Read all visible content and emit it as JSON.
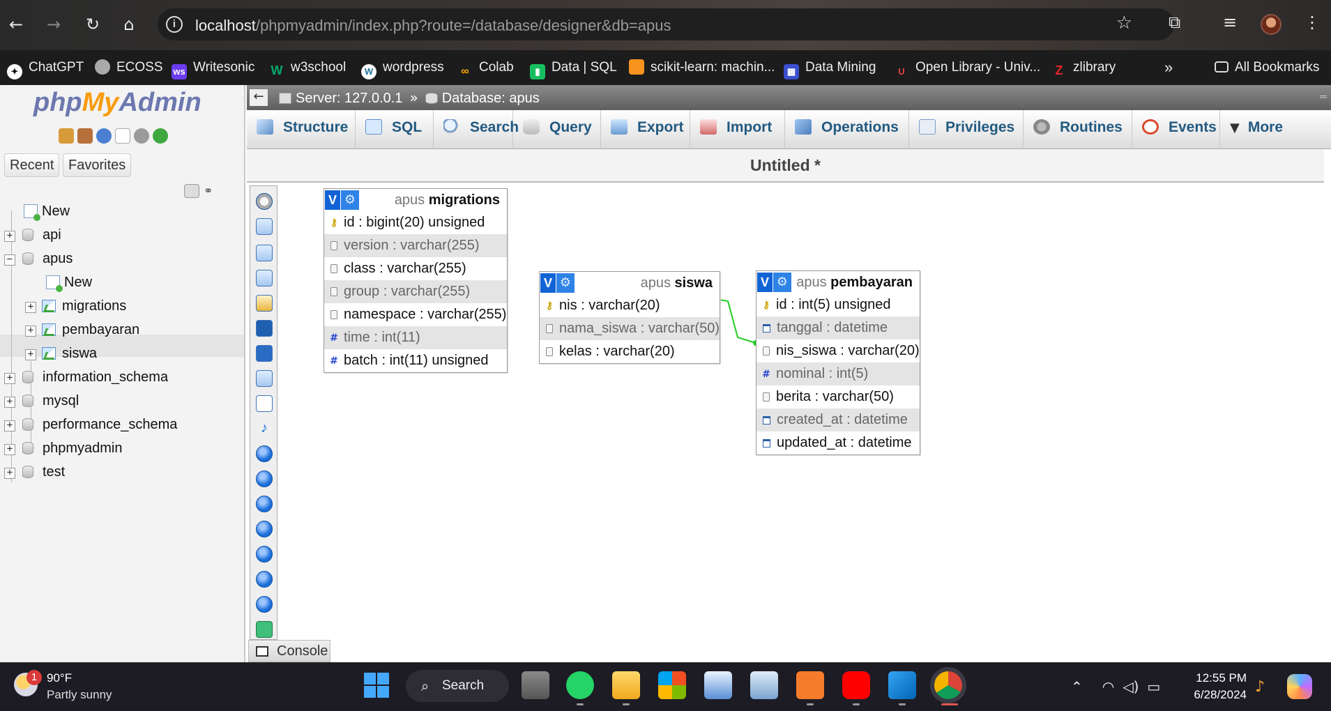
{
  "browser": {
    "url_host": "localhost",
    "url_path": "/phpmyadmin/index.php?route=/database/designer&db=apus",
    "bookmarks": [
      "ChatGPT",
      "ECOSS",
      "Writesonic",
      "w3school",
      "wordpress",
      "Colab",
      "Data | SQL",
      "scikit-learn: machin...",
      "Data Mining",
      "Open Library - Univ...",
      "zlibrary"
    ],
    "more_bookmarks": "»",
    "all_bookmarks": "All Bookmarks"
  },
  "nav": {
    "logo_php": "php",
    "logo_my": "My",
    "logo_admin": "Admin",
    "tabs": [
      "Recent",
      "Favorites"
    ],
    "tree": [
      {
        "label": "New"
      },
      {
        "label": "api"
      },
      {
        "label": "apus"
      },
      {
        "label": "New"
      },
      {
        "label": "migrations"
      },
      {
        "label": "pembayaran"
      },
      {
        "label": "siswa"
      },
      {
        "label": "information_schema"
      },
      {
        "label": "mysql"
      },
      {
        "label": "performance_schema"
      },
      {
        "label": "phpmyadmin"
      },
      {
        "label": "test"
      }
    ]
  },
  "topbar": {
    "server": "Server: 127.0.0.1",
    "sep": "»",
    "database": "Database: apus"
  },
  "tabs": [
    "Structure",
    "SQL",
    "Search",
    "Query",
    "Export",
    "Import",
    "Operations",
    "Privileges",
    "Routines",
    "Events",
    "More"
  ],
  "designer": {
    "title": "Untitled *",
    "tables": [
      {
        "db": "apus",
        "name": "migrations",
        "columns": [
          {
            "text": "id : bigint(20) unsigned",
            "type": "key"
          },
          {
            "text": "version : varchar(255)",
            "type": "txt"
          },
          {
            "text": "class : varchar(255)",
            "type": "txt"
          },
          {
            "text": "group : varchar(255)",
            "type": "txt"
          },
          {
            "text": "namespace : varchar(255)",
            "type": "txt"
          },
          {
            "text": "time : int(11)",
            "type": "num"
          },
          {
            "text": "batch : int(11) unsigned",
            "type": "num"
          }
        ]
      },
      {
        "db": "apus",
        "name": "siswa",
        "columns": [
          {
            "text": "nis : varchar(20)",
            "type": "key"
          },
          {
            "text": "nama_siswa : varchar(50)",
            "type": "txt"
          },
          {
            "text": "kelas : varchar(20)",
            "type": "txt"
          }
        ]
      },
      {
        "db": "apus",
        "name": "pembayaran",
        "columns": [
          {
            "text": "id : int(5) unsigned",
            "type": "key"
          },
          {
            "text": "tanggal : datetime",
            "type": "date"
          },
          {
            "text": "nis_siswa : varchar(20)",
            "type": "txt"
          },
          {
            "text": "nominal : int(5)",
            "type": "num"
          },
          {
            "text": "berita : varchar(50)",
            "type": "txt"
          },
          {
            "text": "created_at : datetime",
            "type": "date"
          },
          {
            "text": "updated_at : datetime",
            "type": "date"
          }
        ]
      }
    ],
    "relation_color": "#22cc22"
  },
  "console": "Console",
  "taskbar": {
    "weather_badge": "1",
    "temp": "90°F",
    "condition": "Partly sunny",
    "search": "Search",
    "time": "12:55 PM",
    "date": "6/28/2024"
  }
}
